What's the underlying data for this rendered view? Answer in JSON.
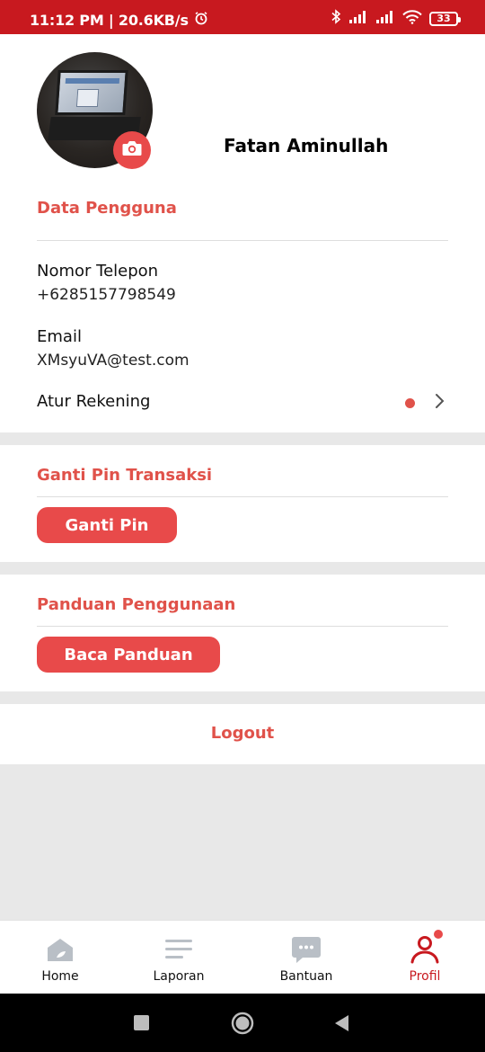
{
  "status_bar": {
    "time": "11:12 PM | 20.6KB/s",
    "battery": "33",
    "icons": [
      "alarm-icon",
      "bluetooth-icon",
      "signal-icon",
      "signal-icon",
      "wifi-icon",
      "battery-icon"
    ]
  },
  "profile": {
    "name": "Fatan Aminullah"
  },
  "user_data": {
    "section_title": "Data Pengguna",
    "phone_label": "Nomor Telepon",
    "phone_value": "+6285157798549",
    "email_label": "Email",
    "email_value": "XMsyuVA@test.com",
    "account_label": "Atur Rekening"
  },
  "pin": {
    "section_title": "Ganti Pin Transaksi",
    "button_label": "Ganti Pin"
  },
  "guide": {
    "section_title": "Panduan Penggunaan",
    "button_label": "Baca Panduan"
  },
  "logout_label": "Logout",
  "bottom_nav": {
    "items": [
      {
        "label": "Home",
        "icon": "home-icon"
      },
      {
        "label": "Laporan",
        "icon": "list-icon"
      },
      {
        "label": "Bantuan",
        "icon": "chat-icon"
      },
      {
        "label": "Profil",
        "icon": "person-icon",
        "active": true
      }
    ]
  },
  "colors": {
    "status_bar": "#c8191f",
    "accent": "#e0524a",
    "button": "#e84a4a",
    "nav_inactive": "#b9bfc6"
  }
}
